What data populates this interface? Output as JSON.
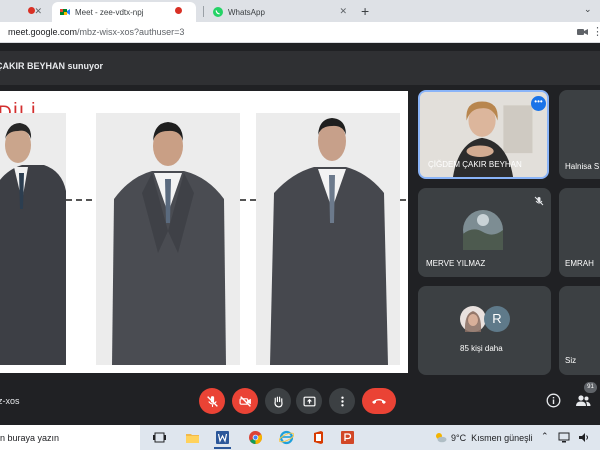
{
  "browser": {
    "tabs": [
      {
        "title": "Meet - zee-vdtx-npj",
        "active": true
      },
      {
        "title": "WhatsApp",
        "active": false
      }
    ],
    "url_host": "meet.google.com",
    "url_path": "/mbz-wisx-xos?authuser=3"
  },
  "meet": {
    "presenting_text": "ÇAKIR BEYHAN sunuyor",
    "slide_title": "DİLİ",
    "participants": [
      {
        "name": "ÇİĞDEM ÇAKIR BEYHAN"
      },
      {
        "name": "Halnisa S"
      },
      {
        "name": "MERVE YILMAZ"
      },
      {
        "name": "EMRAH"
      },
      {
        "name": "85 kişi daha",
        "avatar_letter": "R"
      },
      {
        "name": "Siz"
      }
    ],
    "meeting_code": "z-xos",
    "participant_count": "91",
    "colors": {
      "accent": "#1a73e8",
      "danger": "#ea4335",
      "tile": "#3c4043",
      "background": "#202124"
    }
  },
  "taskbar": {
    "search_text": "n buraya yazın",
    "weather_temp": "9°C",
    "weather_desc": "Kısmen güneşli",
    "icons": [
      "task-view-icon",
      "file-explorer-icon",
      "word-icon",
      "chrome-icon",
      "ie-icon",
      "office-icon",
      "powerpoint-icon"
    ]
  }
}
